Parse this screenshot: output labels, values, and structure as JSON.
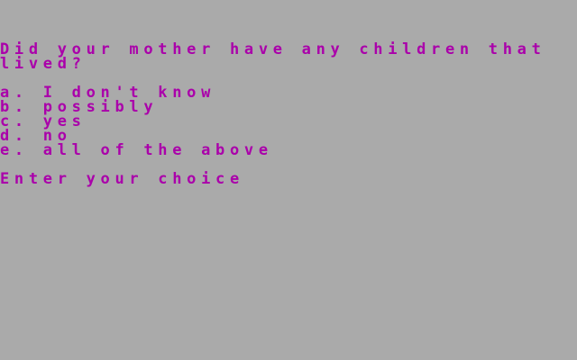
{
  "colors": {
    "background": "#aaaaaa",
    "text": "#aa00aa"
  },
  "question": {
    "line1": "Did your mother have any children that",
    "line2": "lived?"
  },
  "options": [
    {
      "text": "a. I don't know"
    },
    {
      "text": "b. possibly"
    },
    {
      "text": "c. yes"
    },
    {
      "text": "d. no"
    },
    {
      "text": "e. all of the above"
    }
  ],
  "prompt": {
    "text": "Enter your choice"
  }
}
